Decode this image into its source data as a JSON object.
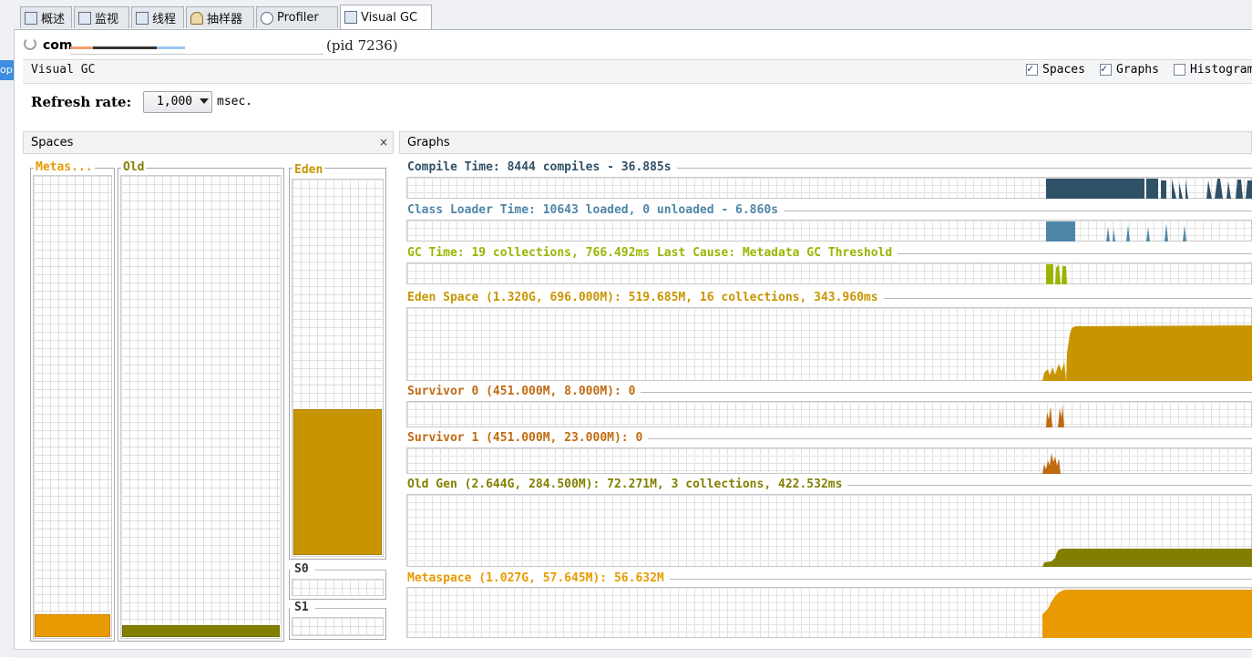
{
  "tabs": [
    {
      "label": "概述",
      "icon": "overview-icon"
    },
    {
      "label": "监视",
      "icon": "monitor-icon"
    },
    {
      "label": "线程",
      "icon": "threads-icon"
    },
    {
      "label": "抽样器",
      "icon": "sampler-icon"
    },
    {
      "label": "Profiler",
      "icon": "clock-icon"
    },
    {
      "label": "Visual GC",
      "icon": "visualgc-icon",
      "active": true
    }
  ],
  "left_strip": {
    "label": "op"
  },
  "process": {
    "name": "com",
    "pid": "(pid 7236)"
  },
  "toolbar": {
    "title": "Visual GC",
    "checkboxes": [
      {
        "label": "Spaces",
        "checked": true
      },
      {
        "label": "Graphs",
        "checked": true
      },
      {
        "label": "Histogram",
        "checked": false
      }
    ]
  },
  "refresh": {
    "label": "Refresh rate:",
    "value": "1,000",
    "unit": "msec."
  },
  "spaces_panel": {
    "title": "Spaces",
    "close_glyph": "×",
    "columns": [
      {
        "label": "Metas...",
        "color": "#e89a00",
        "fill_fraction": 0.05
      },
      {
        "label": "Old",
        "color": "#827f00",
        "fill_fraction": 0.026
      },
      {
        "label": "Eden",
        "color": "#c89500",
        "fill_fraction": 0.39
      },
      {
        "label": "S0",
        "color": "#c06a10",
        "fill_fraction": 0.0
      },
      {
        "label": "S1",
        "color": "#c06a10",
        "fill_fraction": 0.0
      }
    ]
  },
  "graphs_panel": {
    "title": "Graphs",
    "graphs": [
      {
        "label": "Compile Time: 8444 compiles - 36.885s",
        "color": "#2f5168"
      },
      {
        "label": "Class Loader Time: 10643 loaded, 0 unloaded - 6.860s",
        "color": "#4f86a8"
      },
      {
        "label": "GC Time: 19 collections, 766.492ms Last Cause: Metadata GC Threshold",
        "color": "#9cb400"
      },
      {
        "label": "Eden Space (1.320G, 696.000M): 519.685M, 16 collections, 343.960ms",
        "color": "#c89500"
      },
      {
        "label": "Survivor 0 (451.000M, 8.000M): 0",
        "color": "#c06a10"
      },
      {
        "label": "Survivor 1 (451.000M, 23.000M): 0",
        "color": "#c06a10"
      },
      {
        "label": "Old Gen (2.644G, 284.500M): 72.271M, 3 collections, 422.532ms",
        "color": "#827f00"
      },
      {
        "label": "Metaspace (1.027G, 57.645M): 56.632M",
        "color": "#e89a00"
      }
    ]
  }
}
